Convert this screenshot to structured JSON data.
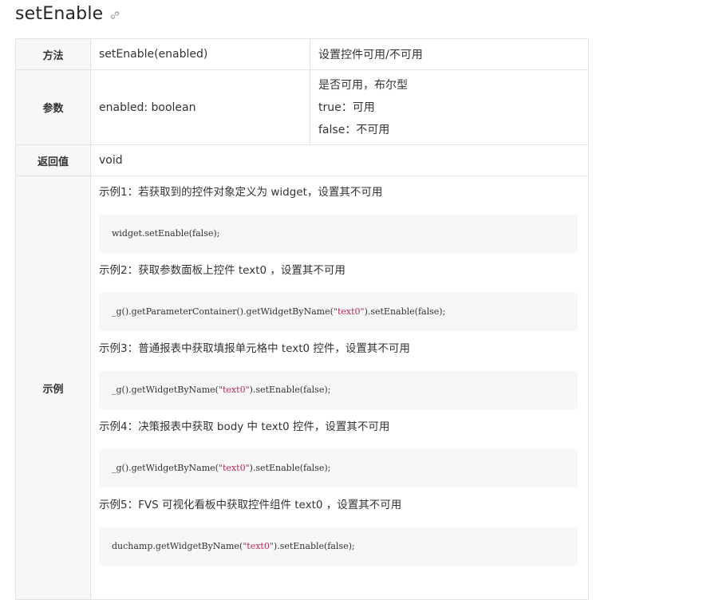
{
  "title": "setEnable",
  "rows": {
    "method": {
      "key": "方法",
      "signature": "setEnable(enabled)",
      "description": "设置控件可用/不可用"
    },
    "params": {
      "key": "参数",
      "name": "enabled: boolean",
      "desc_lines": [
        "是否可用，布尔型",
        "true：可用",
        "false：不可用"
      ]
    },
    "return": {
      "key": "返回值",
      "value": "void"
    },
    "example": {
      "key": "示例"
    }
  },
  "examples": [
    {
      "title": "示例1：若获取到的控件对象定义为 widget，设置其不可用",
      "code_pre": "widget.setEnable(false);",
      "code_str": "",
      "code_post": ""
    },
    {
      "title": "示例2：获取参数面板上控件 text0 ，设置其不可用",
      "code_pre": "_g().getParameterContainer().getWidgetByName(",
      "code_str": "\"text0\"",
      "code_post": ").setEnable(false);"
    },
    {
      "title": "示例3：普通报表中获取填报单元格中 text0 控件，设置其不可用",
      "code_pre": "_g().getWidgetByName(",
      "code_str": "\"text0\"",
      "code_post": ").setEnable(false);"
    },
    {
      "title": "示例4：决策报表中获取 body 中 text0 控件，设置其不可用",
      "code_pre": "_g().getWidgetByName(",
      "code_str": "\"text0\"",
      "code_post": ").setEnable(false);"
    },
    {
      "title": "示例5：FVS 可视化看板中获取控件组件 text0 ，设置其不可用",
      "code_pre": "duchamp.getWidgetByName(",
      "code_str": "\"text0\"",
      "code_post": ").setEnable(false);"
    }
  ],
  "colors": {
    "string_literal": "#b02e53",
    "key_bg": "#f7f7f7",
    "code_bg": "#f6f6f6",
    "border": "#e3e3e3"
  }
}
